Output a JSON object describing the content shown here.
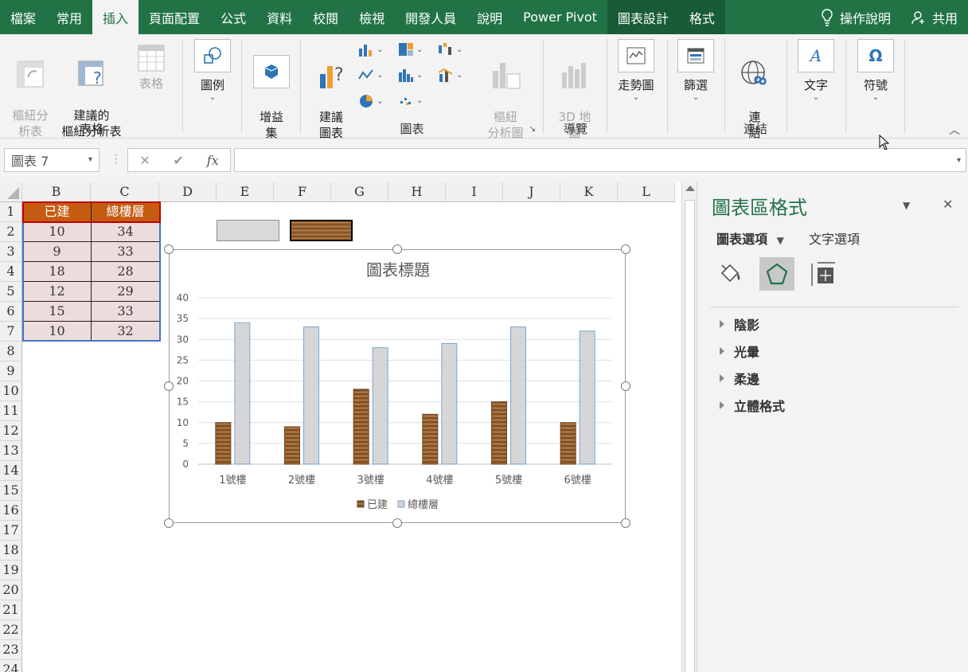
{
  "menu": {
    "tabs": [
      "檔案",
      "常用",
      "插入",
      "頁面配置",
      "公式",
      "資料",
      "校閱",
      "檢視",
      "開發人員",
      "說明",
      "Power Pivot",
      "圖表設計",
      "格式"
    ],
    "tell_me": "操作說明",
    "share": "共用"
  },
  "ribbon": {
    "pivot": "樞紐分\n析表",
    "rec_pivot": "建議的\n樞紐分析表",
    "table": "表格",
    "group_tables": "表格",
    "illustrations": "圖例",
    "addins": "增益\n集",
    "rec_charts": "建議\n圖表",
    "pivot_chart": "樞紐\n分析圖",
    "group_charts": "圖表",
    "map3d": "3D 地\n圖",
    "group_tours": "導覽",
    "sparklines": "走勢圖",
    "filters": "篩選",
    "link": "連\n結",
    "group_links": "連結",
    "text": "文字",
    "symbols": "符號"
  },
  "formula_bar": {
    "name_box": "圖表 7",
    "cancel": "✕",
    "enter": "✔",
    "fx": "fx",
    "value": ""
  },
  "grid": {
    "columns": [
      "B",
      "C",
      "D",
      "E",
      "F",
      "G",
      "H",
      "I",
      "J",
      "K",
      "L"
    ],
    "rows": [
      "1",
      "2",
      "3",
      "4",
      "5",
      "6",
      "7",
      "8",
      "9",
      "10",
      "11",
      "12",
      "13",
      "14",
      "15",
      "16",
      "17",
      "18",
      "19",
      "20",
      "21",
      "22",
      "23",
      "24"
    ],
    "table_headers": [
      "已建",
      "總樓層"
    ],
    "table_rows": [
      [
        "10",
        "34"
      ],
      [
        "9",
        "33"
      ],
      [
        "18",
        "28"
      ],
      [
        "12",
        "29"
      ],
      [
        "15",
        "33"
      ],
      [
        "10",
        "32"
      ]
    ]
  },
  "chart_data": {
    "type": "bar",
    "title": "圖表標題",
    "categories": [
      "1號樓",
      "2號樓",
      "3號樓",
      "4號樓",
      "5號樓",
      "6號樓"
    ],
    "series": [
      {
        "name": "已建",
        "values": [
          10,
          9,
          18,
          12,
          15,
          10
        ],
        "fill": "wood-texture"
      },
      {
        "name": "總樓層",
        "values": [
          34,
          33,
          28,
          29,
          33,
          32
        ],
        "fill": "light-gray-texture"
      }
    ],
    "ylim": [
      0,
      40
    ],
    "yticks": [
      0,
      5,
      10,
      15,
      20,
      25,
      30,
      35,
      40
    ],
    "grid": true,
    "legend": "bottom"
  },
  "pane": {
    "title": "圖表區格式",
    "tab_chart": "圖表選項",
    "tab_text": "文字選項",
    "sections": [
      "陰影",
      "光暈",
      "柔邊",
      "立體格式"
    ]
  },
  "colors": {
    "excel_green": "#217346",
    "header_orange": "#c55a11",
    "cell_pink": "#ecdddc",
    "wood": "#8b5a2b",
    "gray_fill": "#d9d9d9"
  }
}
